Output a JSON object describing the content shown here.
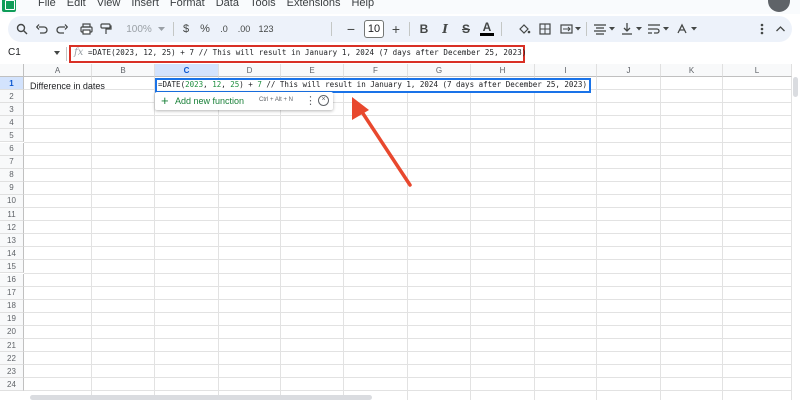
{
  "menu": [
    "File",
    "Edit",
    "View",
    "Insert",
    "Format",
    "Data",
    "Tools",
    "Extensions",
    "Help"
  ],
  "toolbar": {
    "zoom": "100%",
    "currency": "$",
    "percent": "%",
    "decimal_decrease": ".0",
    "decimal_increase": ".00",
    "number_format": "123",
    "font_size_minus": "−",
    "font_size": "10",
    "font_size_plus": "+",
    "bold": "B",
    "italic": "I",
    "strikethrough": "S",
    "text_color": "A"
  },
  "formula_bar": {
    "name_box": "C1",
    "fx": "fx",
    "formula": "=DATE(2023, 12, 25) + 7  // This will result in January 1, 2024 (7 days after December 25, 2023)"
  },
  "grid": {
    "columns": [
      "A",
      "B",
      "C",
      "D",
      "E",
      "F",
      "G",
      "H",
      "I",
      "J",
      "K",
      "L"
    ],
    "rows": [
      "1",
      "2",
      "3",
      "4",
      "5",
      "6",
      "7",
      "8",
      "9",
      "10",
      "11",
      "12",
      "13",
      "14",
      "15",
      "16",
      "17",
      "18",
      "19",
      "20",
      "21",
      "22",
      "23",
      "24"
    ],
    "selected_column": "C",
    "selected_row": "1",
    "cell_a1": "Difference in dates",
    "cell_c1": {
      "prefix": "=DATE(",
      "arg1": "2023",
      "sep1": ", ",
      "arg2": "12",
      "sep2": ", ",
      "arg3": "25",
      "mid": ") + ",
      "arg4": "7",
      "comment": "  // This will result in January 1, 2024 (7 days after December 25, 2023)"
    }
  },
  "suggestion": {
    "plus": "+",
    "label": "Add new function",
    "shortcut": "Ctrl + Alt + N",
    "more": "⋮",
    "close": "×"
  },
  "colors": {
    "annotation": "#d93025",
    "selection": "#1a73e8",
    "accent_green": "#188038"
  }
}
